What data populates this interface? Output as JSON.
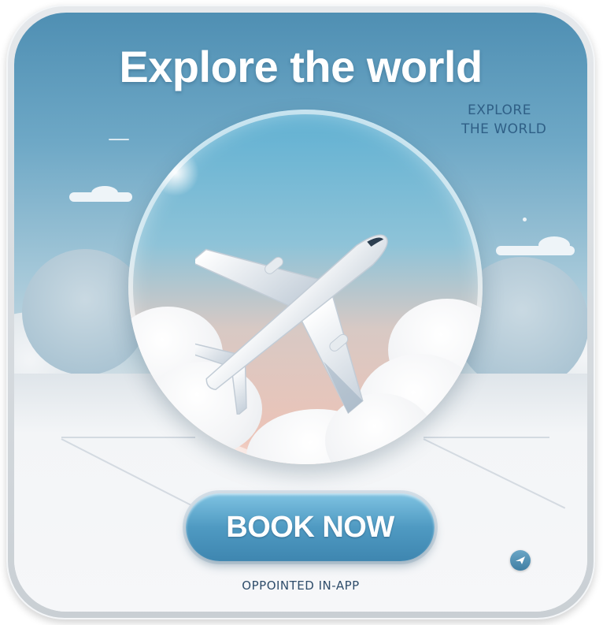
{
  "banner": {
    "headline": "Explore the world",
    "side_text_line1": "EXPLORE",
    "side_text_line2": "THE WORLD",
    "cta_label": "BOOK NOW",
    "footer_text": "OPPOINTED IN-APP"
  },
  "colors": {
    "sky_top": "#4f8fb3",
    "button": "#4f9ac2",
    "headline": "#ffffff",
    "globe_bottom": "#f1c2b4"
  },
  "icons": {
    "hero": "airplane-icon",
    "badge": "plane-badge-icon"
  }
}
